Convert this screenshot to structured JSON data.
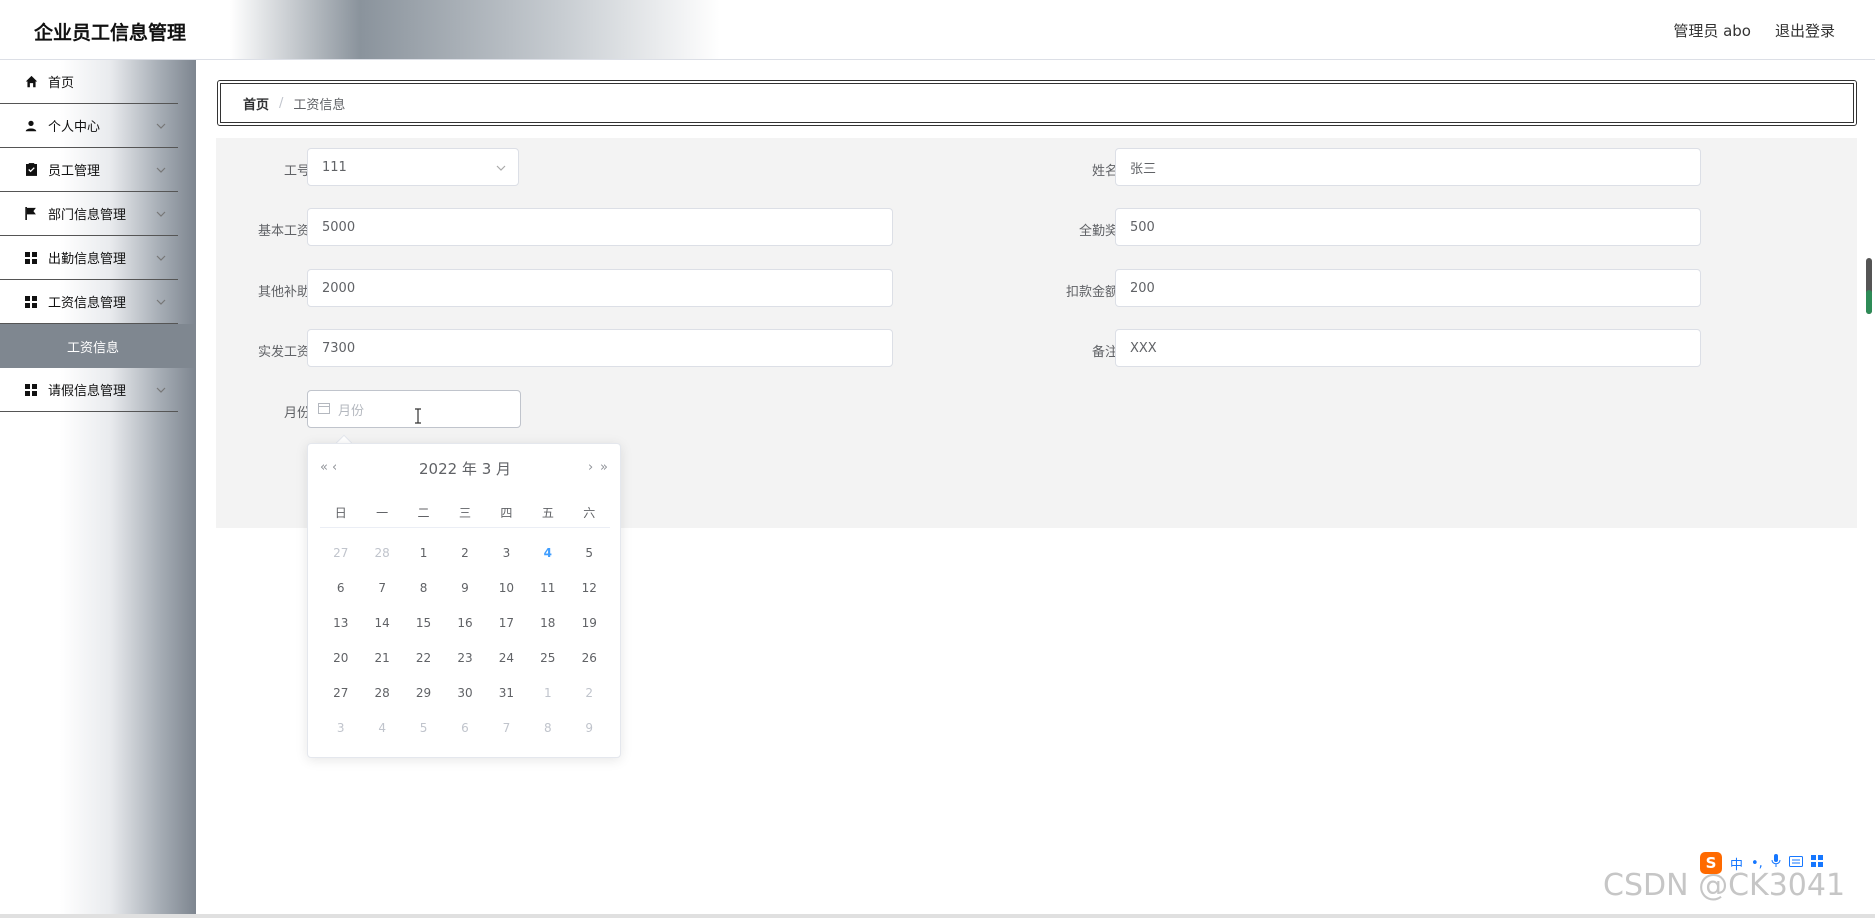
{
  "header": {
    "title": "企业员工信息管理",
    "user": "管理员 abo",
    "logout": "退出登录"
  },
  "sidebar": {
    "items": [
      {
        "label": "首页",
        "icon": "home-icon",
        "has_children": false
      },
      {
        "label": "个人中心",
        "icon": "user-icon",
        "has_children": true
      },
      {
        "label": "员工管理",
        "icon": "clipboard-icon",
        "has_children": true
      },
      {
        "label": "部门信息管理",
        "icon": "flag-icon",
        "has_children": true
      },
      {
        "label": "出勤信息管理",
        "icon": "grid-icon",
        "has_children": true
      },
      {
        "label": "工资信息管理",
        "icon": "grid-icon",
        "has_children": true,
        "expanded": true
      },
      {
        "label": "请假信息管理",
        "icon": "grid-icon",
        "has_children": true
      }
    ],
    "active_submenu": "工资信息"
  },
  "breadcrumb": {
    "home": "首页",
    "separator": "/",
    "current": "工资信息"
  },
  "form": {
    "job_no": {
      "label": "工号",
      "value": "111"
    },
    "name": {
      "label": "姓名",
      "value": "张三"
    },
    "base_salary": {
      "label": "基本工资",
      "value": "5000"
    },
    "attendance_bonus": {
      "label": "全勤奖",
      "value": "500"
    },
    "other_allowance": {
      "label": "其他补助",
      "value": "2000"
    },
    "deduction": {
      "label": "扣款金额",
      "value": "200"
    },
    "net_salary": {
      "label": "实发工资",
      "value": "7300"
    },
    "remark": {
      "label": "备注",
      "value": "XXX"
    },
    "month": {
      "label": "月份",
      "placeholder": "月份"
    }
  },
  "datepicker": {
    "prev_year": "«",
    "prev_month": "‹",
    "next_month": "›",
    "next_year": "»",
    "title": "2022 年  3 月",
    "weekdays": [
      "日",
      "一",
      "二",
      "三",
      "四",
      "五",
      "六"
    ],
    "weeks": [
      [
        {
          "d": "27",
          "o": true
        },
        {
          "d": "28",
          "o": true
        },
        {
          "d": "1"
        },
        {
          "d": "2"
        },
        {
          "d": "3"
        },
        {
          "d": "4",
          "t": true
        },
        {
          "d": "5"
        }
      ],
      [
        {
          "d": "6"
        },
        {
          "d": "7"
        },
        {
          "d": "8"
        },
        {
          "d": "9"
        },
        {
          "d": "10"
        },
        {
          "d": "11"
        },
        {
          "d": "12"
        }
      ],
      [
        {
          "d": "13"
        },
        {
          "d": "14"
        },
        {
          "d": "15"
        },
        {
          "d": "16"
        },
        {
          "d": "17"
        },
        {
          "d": "18"
        },
        {
          "d": "19"
        }
      ],
      [
        {
          "d": "20"
        },
        {
          "d": "21"
        },
        {
          "d": "22"
        },
        {
          "d": "23"
        },
        {
          "d": "24"
        },
        {
          "d": "25"
        },
        {
          "d": "26"
        }
      ],
      [
        {
          "d": "27"
        },
        {
          "d": "28"
        },
        {
          "d": "29"
        },
        {
          "d": "30"
        },
        {
          "d": "31"
        },
        {
          "d": "1",
          "o": true
        },
        {
          "d": "2",
          "o": true
        }
      ],
      [
        {
          "d": "3",
          "o": true
        },
        {
          "d": "4",
          "o": true
        },
        {
          "d": "5",
          "o": true
        },
        {
          "d": "6",
          "o": true
        },
        {
          "d": "7",
          "o": true
        },
        {
          "d": "8",
          "o": true
        },
        {
          "d": "9",
          "o": true
        }
      ]
    ]
  },
  "ime": {
    "logo": "S",
    "mode": "中",
    "punct": "•,"
  },
  "watermark": "CSDN @CK3041",
  "colors": {
    "today": "#409eff",
    "submenu_bg": "#7f8790"
  }
}
